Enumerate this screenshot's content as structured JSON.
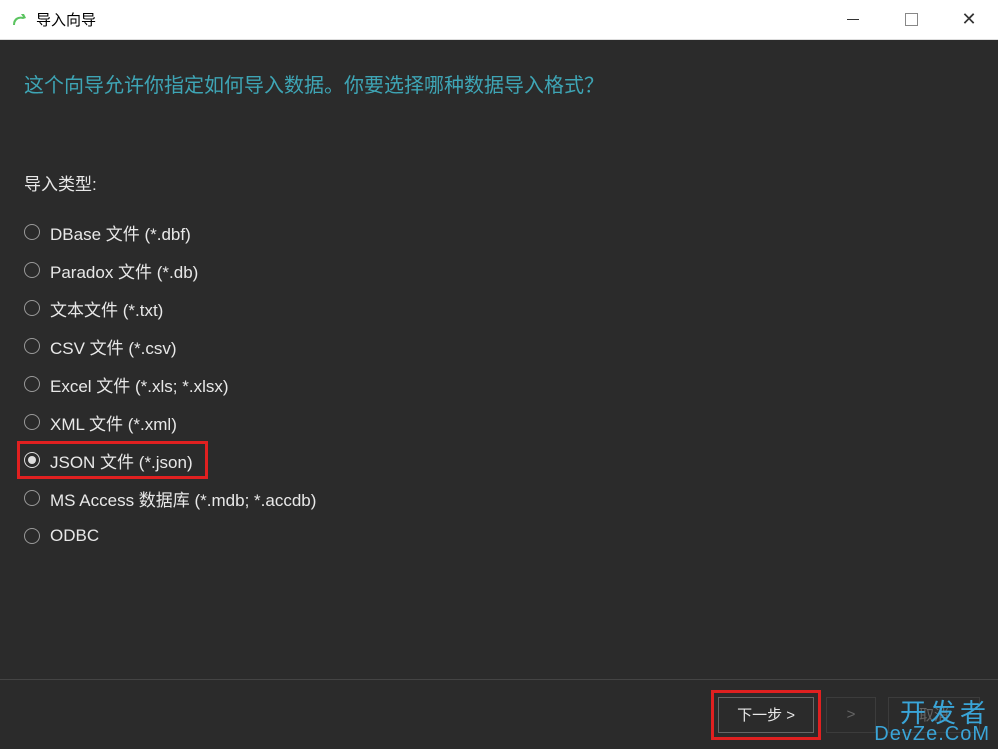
{
  "titlebar": {
    "title": "导入向导"
  },
  "header": {
    "text": "这个向导允许你指定如何导入数据。你要选择哪种数据导入格式？"
  },
  "import_type": {
    "label": "导入类型:",
    "options": [
      {
        "label": "DBase 文件 (*.dbf)",
        "selected": false,
        "highlighted": false
      },
      {
        "label": "Paradox 文件 (*.db)",
        "selected": false,
        "highlighted": false
      },
      {
        "label": "文本文件 (*.txt)",
        "selected": false,
        "highlighted": false
      },
      {
        "label": "CSV 文件 (*.csv)",
        "selected": false,
        "highlighted": false
      },
      {
        "label": "Excel 文件 (*.xls; *.xlsx)",
        "selected": false,
        "highlighted": false
      },
      {
        "label": "XML 文件 (*.xml)",
        "selected": false,
        "highlighted": false
      },
      {
        "label": "JSON 文件 (*.json)",
        "selected": true,
        "highlighted": true
      },
      {
        "label": "MS Access 数据库 (*.mdb; *.accdb)",
        "selected": false,
        "highlighted": false
      },
      {
        "label": "ODBC",
        "selected": false,
        "highlighted": false
      }
    ]
  },
  "footer": {
    "next_label": "下一步 >",
    "next_highlighted": true,
    "cancel_label": "取消"
  },
  "watermark": {
    "line1": "开发者",
    "line2": "DevZe.CoM"
  }
}
